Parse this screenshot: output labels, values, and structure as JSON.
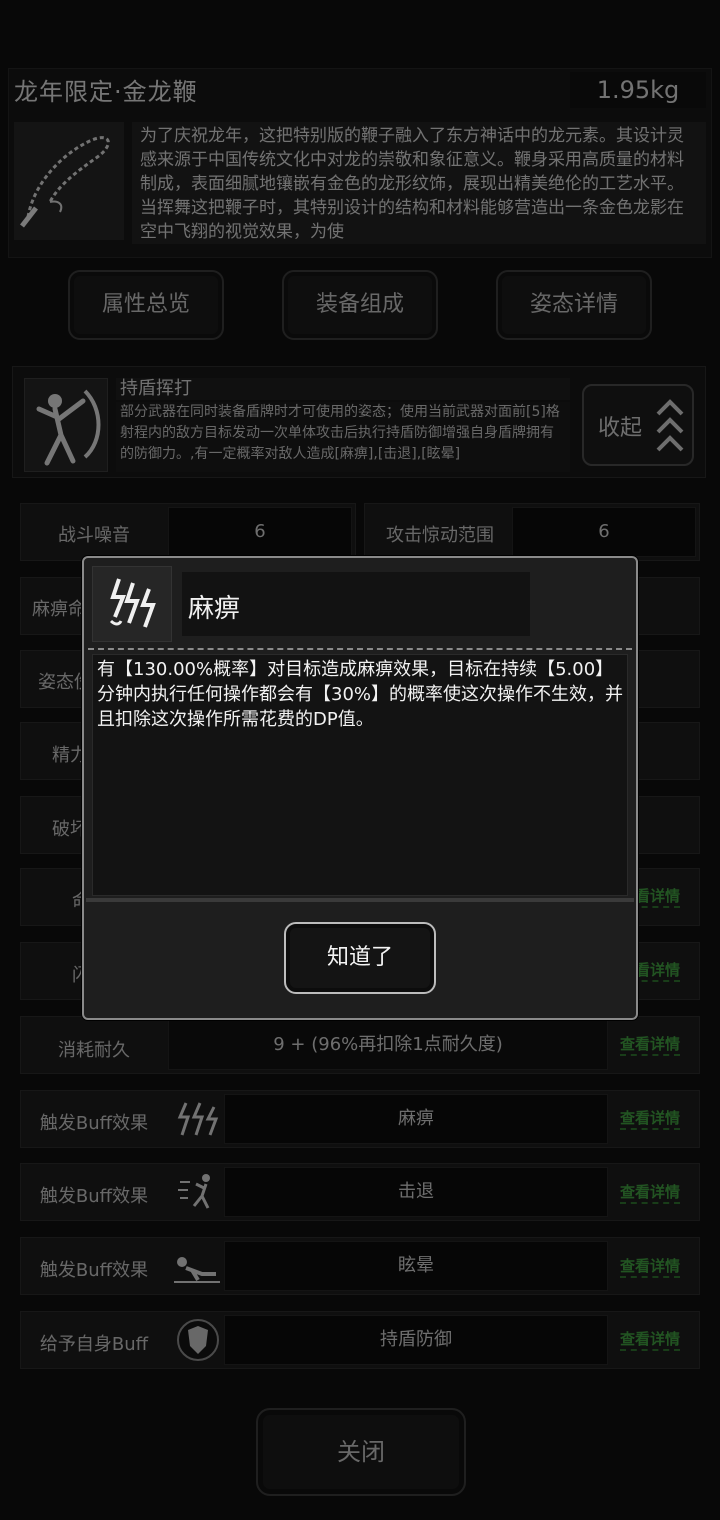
{
  "item": {
    "title": "龙年限定·金龙鞭",
    "weight": "1.95kg",
    "icon": "whip-icon",
    "description": "为了庆祝龙年，这把特别版的鞭子融入了东方神话中的龙元素。其设计灵感来源于中国传统文化中对龙的崇敬和象征意义。鞭身采用高质量的材料制成，表面细腻地镶嵌有金色的龙形纹饰，展现出精美绝伦的工艺水平。当挥舞这把鞭子时，其特别设计的结构和材料能够营造出一条金色龙影在空中飞翔的视觉效果，为使"
  },
  "tabs": {
    "overview": "属性总览",
    "composition": "装备组成",
    "stance": "姿态详情"
  },
  "stance": {
    "name": "持盾挥打",
    "description": "部分武器在同时装备盾牌时才可使用的姿态；使用当前武器对面前[5]格射程内的敌方目标发动一次单体攻击后执行持盾防御增强自身盾牌拥有的防御力。,有一定概率对敌人造成[麻痹],[击退],[眩晕]",
    "collapse_label": "收起",
    "icon": "shield-strike-icon"
  },
  "stats": {
    "noise_label": "战斗噪音",
    "noise_value": "6",
    "alert_label": "攻击惊动范围",
    "alert_value": "6",
    "r2_label": "麻痹命",
    "r3_label": "姿态伤",
    "r4_label": "精力",
    "r5_label": "破坏",
    "r6_label": "命",
    "r7_label": "闪",
    "durability_label": "消耗耐久",
    "durability_value": "9 + (96%再扣除1点耐久度)"
  },
  "buffs": [
    {
      "label": "触发Buff效果",
      "name": "麻痹",
      "icon": "paralysis-icon"
    },
    {
      "label": "触发Buff效果",
      "name": "击退",
      "icon": "knockback-icon"
    },
    {
      "label": "触发Buff效果",
      "name": "眩晕",
      "icon": "stun-icon"
    },
    {
      "label": "给予自身Buff",
      "name": "持盾防御",
      "icon": "shield-icon"
    }
  ],
  "link_label": "查看详情",
  "close_label": "关闭",
  "dialog": {
    "title": "麻痹",
    "icon": "paralysis-icon",
    "body": "有【130.00%概率】对目标造成麻痹效果，目标在持续【5.00】分钟内执行任何操作都会有【30%】的概率使这次操作不生效，并且扣除这次操作所需花费的DP值。",
    "ok_label": "知道了"
  },
  "colors": {
    "link": "#3f9a3f",
    "background": "#0f0f0f",
    "dialog_border": "#8a8a8a"
  }
}
